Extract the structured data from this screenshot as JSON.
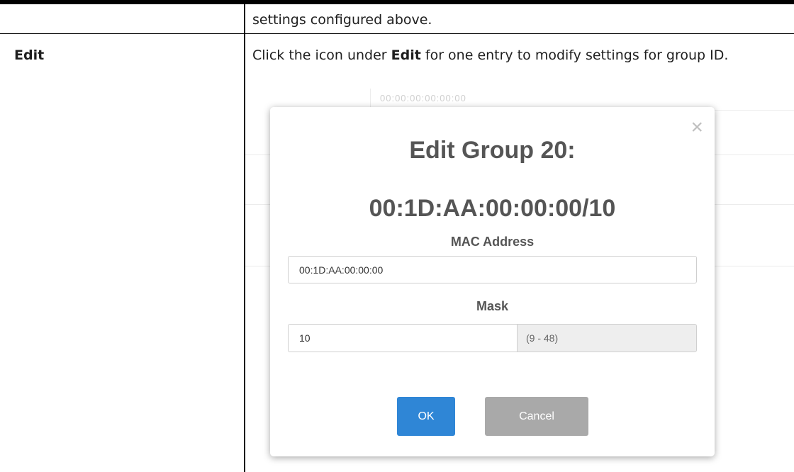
{
  "previous_row": {
    "text": "settings configured above."
  },
  "edit_row": {
    "label": "Edit",
    "desc_pre": "Click the icon under ",
    "desc_bold": "Edit",
    "desc_post": " for one entry to modify settings for group ID."
  },
  "background": {
    "faded_text": "00:00:00:00:00:00"
  },
  "dialog": {
    "title": "Edit Group 20:",
    "subtitle": "00:1D:AA:00:00:00/10",
    "close_symbol": "×",
    "mac_label": "MAC Address",
    "mac_value": "00:1D:AA:00:00:00",
    "mask_label": "Mask",
    "mask_value": "10",
    "mask_range": "(9 - 48)",
    "ok_label": "OK",
    "cancel_label": "Cancel"
  },
  "colors": {
    "ok_button": "#2f86d6",
    "cancel_button": "#a9a9a9",
    "heading_text": "#555555"
  }
}
